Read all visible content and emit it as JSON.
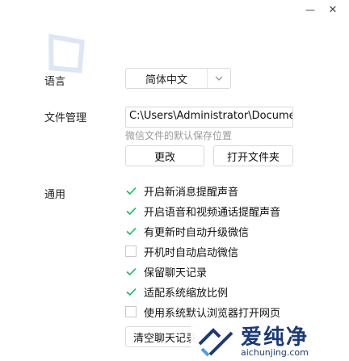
{
  "window": {
    "minimize_label": "—",
    "close_label": "✕"
  },
  "language": {
    "label": "语言",
    "value": "简体中文"
  },
  "file_management": {
    "label": "文件管理",
    "path": "C:\\Users\\Administrator\\Documents\\WeChat Files",
    "hint": "微信文件的默认保存位置",
    "change_button": "更改",
    "open_folder_button": "打开文件夹"
  },
  "general": {
    "label": "通用",
    "options": [
      {
        "text": "开启新消息提醒声音",
        "checked": true
      },
      {
        "text": "开启语音和视频通话提醒声音",
        "checked": true
      },
      {
        "text": "有更新时自动升级微信",
        "checked": true
      },
      {
        "text": "开机时自动启动微信",
        "checked": false
      },
      {
        "text": "保留聊天记录",
        "checked": true
      },
      {
        "text": "适配系统缩放比例",
        "checked": true
      },
      {
        "text": "使用系统默认浏览器打开网页",
        "checked": false
      }
    ],
    "clear_history_button": "清空聊天记录"
  },
  "colors": {
    "check_green": "#07c160",
    "border": "#d9d9d9",
    "hint": "#999999"
  },
  "watermark": {
    "title": "爱纯净",
    "url": "aichunjing.com"
  }
}
